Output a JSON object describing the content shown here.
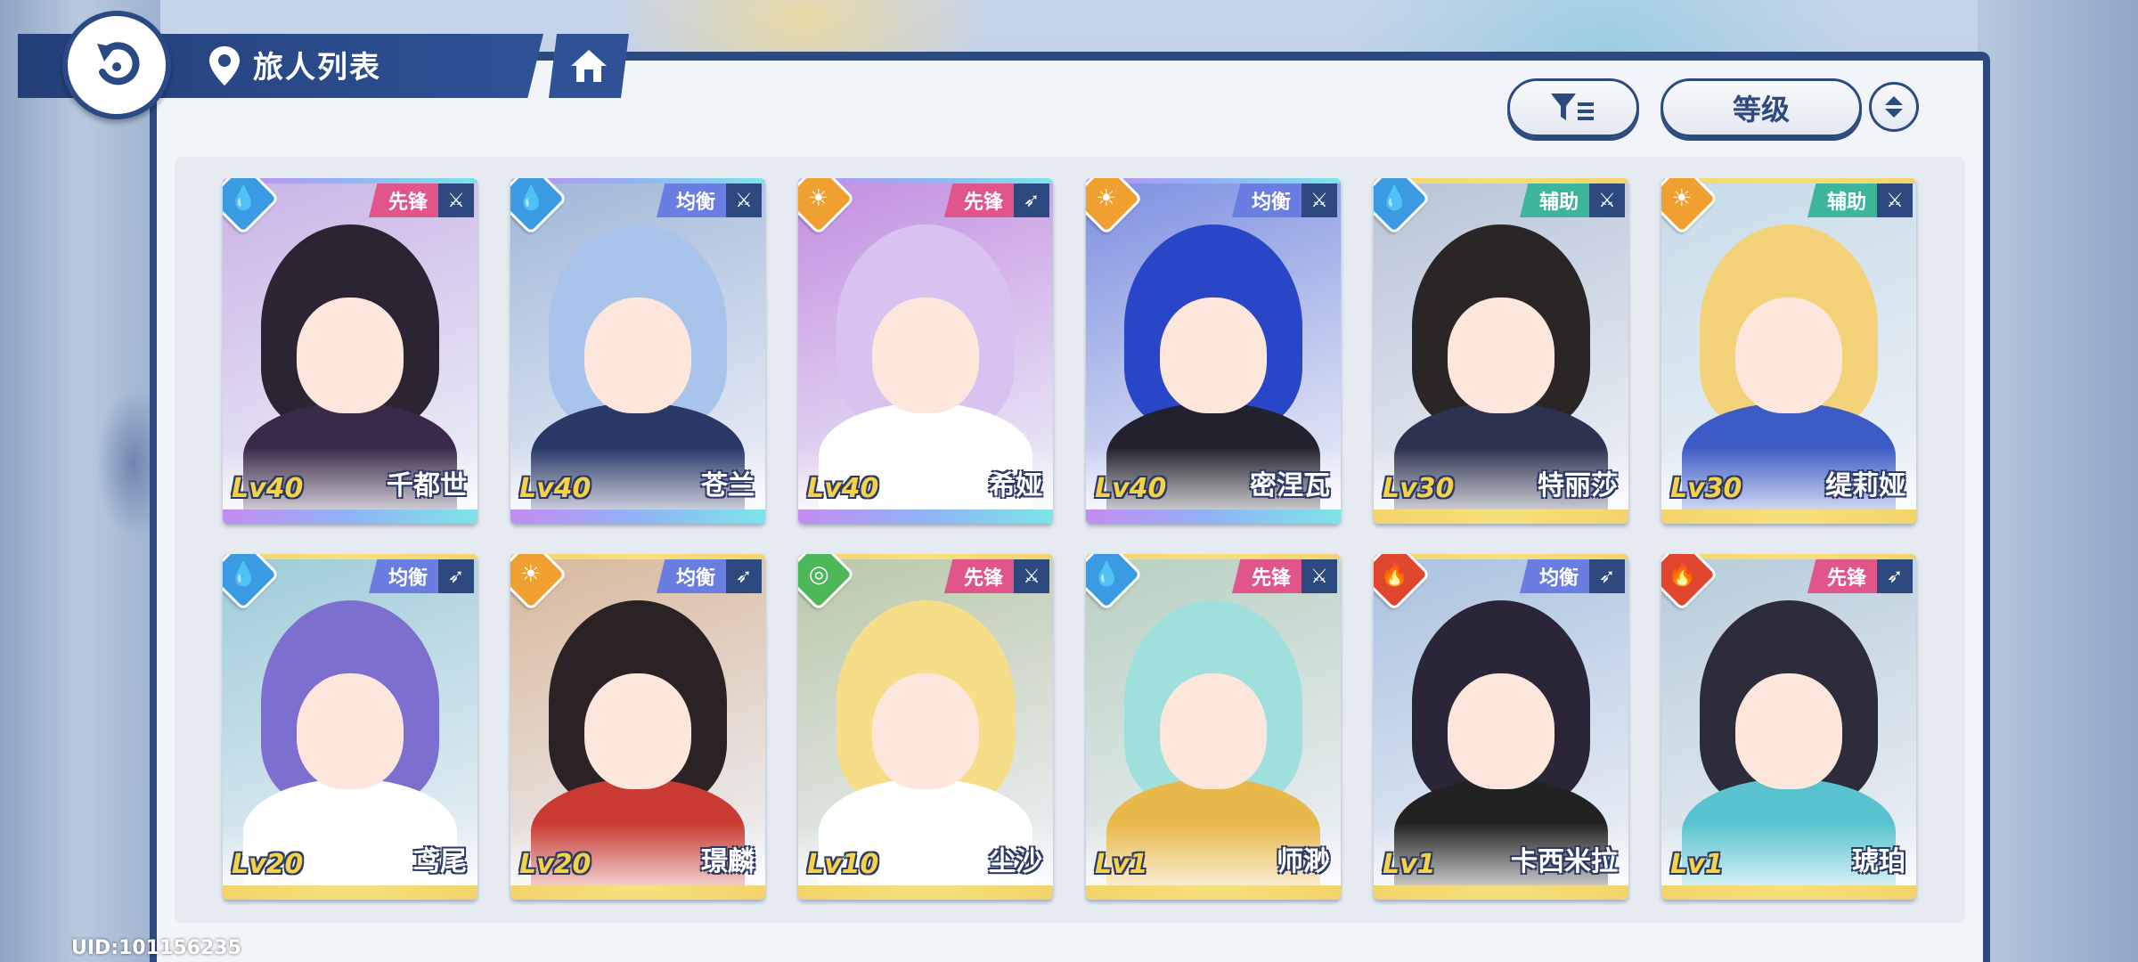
{
  "header": {
    "title": "旅人列表",
    "back_icon": "back-arrow-icon",
    "location_icon": "map-pin-icon",
    "home_icon": "home-icon"
  },
  "toolbar": {
    "filter_icon": "filter-icon",
    "sort_label": "等级",
    "order_icon": "sort-order-icon"
  },
  "colors": {
    "accent": "#2d4a80",
    "role_vanguard": "#e0558a",
    "role_balance": "#6a7de0",
    "role_support": "#3cb59a",
    "elem_water": "#3a9be3",
    "elem_light": "#f0a030",
    "elem_wind": "#4cb85a",
    "elem_fire": "#e0452e"
  },
  "characters": [
    {
      "name": "千都世",
      "level": "Lv40",
      "role": "先锋",
      "element": "water",
      "weapon": "sword",
      "rarity": "rainbow",
      "hair": "#2a2433",
      "outfit": "#3a2a4a",
      "bg": "#c9b3e6"
    },
    {
      "name": "苍兰",
      "level": "Lv40",
      "role": "均衡",
      "element": "water",
      "weapon": "sword",
      "rarity": "rainbow",
      "hair": "#a8c4ea",
      "outfit": "#2a3868",
      "bg": "#9fb6d8"
    },
    {
      "name": "希娅",
      "level": "Lv40",
      "role": "先锋",
      "element": "light",
      "weapon": "bow",
      "rarity": "rainbow",
      "hair": "#d7c2f0",
      "outfit": "#ffffff",
      "bg": "#c28de0"
    },
    {
      "name": "密涅瓦",
      "level": "Lv40",
      "role": "均衡",
      "element": "light",
      "weapon": "sword",
      "rarity": "rainbow",
      "hair": "#2a46c8",
      "outfit": "#22222e",
      "bg": "#7c8ee0"
    },
    {
      "name": "特丽莎",
      "level": "Lv30",
      "role": "辅助",
      "element": "water",
      "weapon": "sword",
      "rarity": "gold",
      "hair": "#2b2626",
      "outfit": "#2c3350",
      "bg": "#b7c3d6"
    },
    {
      "name": "缇莉娅",
      "level": "Lv30",
      "role": "辅助",
      "element": "light",
      "weapon": "sword",
      "rarity": "gold",
      "hair": "#f4d27a",
      "outfit": "#3d5bc4",
      "bg": "#c7dbe8"
    },
    {
      "name": "鸢尾",
      "level": "Lv20",
      "role": "均衡",
      "element": "water",
      "weapon": "bow",
      "rarity": "gold",
      "hair": "#7d6fcf",
      "outfit": "#ffffff",
      "bg": "#9ccbd8"
    },
    {
      "name": "璟麟",
      "level": "Lv20",
      "role": "均衡",
      "element": "light",
      "weapon": "bow",
      "rarity": "gold",
      "hair": "#2a2224",
      "outfit": "#c93a32",
      "bg": "#d8b79a"
    },
    {
      "name": "尘沙",
      "level": "Lv10",
      "role": "先锋",
      "element": "wind",
      "weapon": "sword",
      "rarity": "gold",
      "hair": "#f6de88",
      "outfit": "#ffffff",
      "bg": "#b9c7a8"
    },
    {
      "name": "师渺",
      "level": "Lv1",
      "role": "先锋",
      "element": "water",
      "weapon": "sword",
      "rarity": "gold",
      "hair": "#9fe0dc",
      "outfit": "#e8b84a",
      "bg": "#b8cfc0"
    },
    {
      "name": "卡西米拉",
      "level": "Lv1",
      "role": "均衡",
      "element": "fire",
      "weapon": "bow",
      "rarity": "gold",
      "hair": "#2a2638",
      "outfit": "#222222",
      "bg": "#a9c1de"
    },
    {
      "name": "琥珀",
      "level": "Lv1",
      "role": "先锋",
      "element": "fire",
      "weapon": "bow",
      "rarity": "gold",
      "hair": "#2c2c3a",
      "outfit": "#58c3cf",
      "bg": "#b6cbd9"
    }
  ],
  "footer": {
    "uid": "UID:101156235"
  }
}
